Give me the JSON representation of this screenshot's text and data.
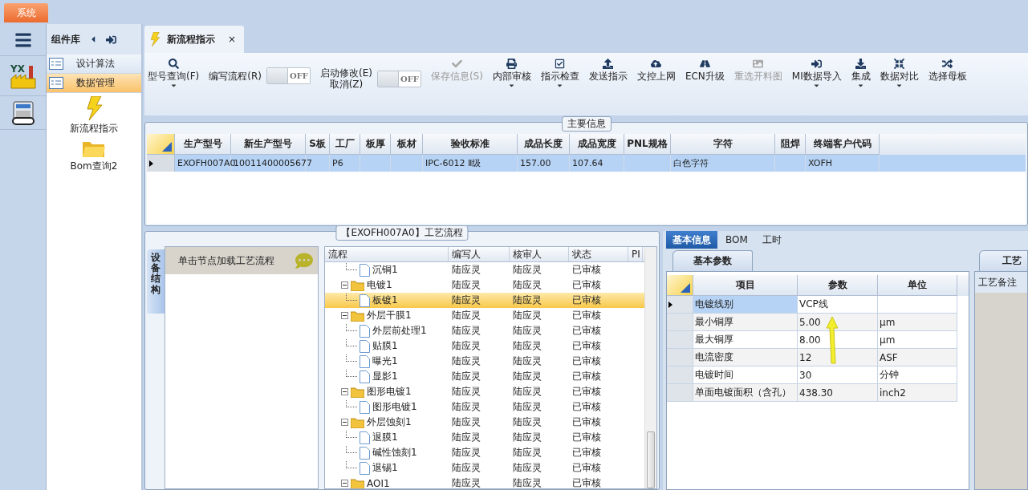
{
  "system_tab": {
    "label": "系统"
  },
  "sidebar": {
    "logo_text": "YX"
  },
  "component_library": {
    "title": "组件库",
    "categories": [
      {
        "label": "设计算法",
        "selected": false
      },
      {
        "label": "数据管理",
        "selected": true
      }
    ],
    "items": [
      {
        "label": "新流程指示"
      },
      {
        "label": "Bom查询2"
      }
    ]
  },
  "document_tab": {
    "title": "新流程指示",
    "close": "×"
  },
  "toolbar": [
    {
      "kind": "button",
      "lines": [
        "型号查询(F)"
      ],
      "dropdown": true,
      "disabled": false
    },
    {
      "kind": "toggle",
      "lines": [
        "编写流程(R)"
      ],
      "state": "OFF",
      "on": false
    },
    {
      "kind": "toggle",
      "lines": [
        "启动修改(E)",
        "取消(Z)"
      ],
      "state": "OFF",
      "on": false
    },
    {
      "kind": "button",
      "lines": [
        "保存信息(S)"
      ],
      "dropdown": false,
      "disabled": true
    },
    {
      "kind": "button",
      "lines": [
        "内部审核"
      ],
      "dropdown": true,
      "disabled": false
    },
    {
      "kind": "button",
      "lines": [
        "指示检查"
      ],
      "dropdown": true,
      "disabled": false
    },
    {
      "kind": "button",
      "lines": [
        "发送指示"
      ],
      "dropdown": false,
      "disabled": false
    },
    {
      "kind": "button",
      "lines": [
        "文控上网"
      ],
      "dropdown": false,
      "disabled": false
    },
    {
      "kind": "button",
      "lines": [
        "ECN升级"
      ],
      "dropdown": false,
      "disabled": false
    },
    {
      "kind": "button",
      "lines": [
        "重选开料图"
      ],
      "dropdown": false,
      "disabled": true
    },
    {
      "kind": "button",
      "lines": [
        "MI数据导入"
      ],
      "dropdown": true,
      "disabled": false
    },
    {
      "kind": "button",
      "lines": [
        "集成"
      ],
      "dropdown": true,
      "disabled": false
    },
    {
      "kind": "button",
      "lines": [
        "数据对比"
      ],
      "dropdown": true,
      "disabled": false
    },
    {
      "kind": "button",
      "lines": [
        "选择母板"
      ],
      "dropdown": false,
      "disabled": false
    }
  ],
  "main_info": {
    "title": "主要信息",
    "columns": [
      "生产型号",
      "新生产型号",
      "S板",
      "工厂",
      "板厚",
      "板材",
      "验收标准",
      "成品长度",
      "成品宽度",
      "PNL规格",
      "字符",
      "阻焊",
      "终端客户代码"
    ],
    "rows": [
      {
        "selected": true,
        "cells": [
          "EXOFH007A0",
          "10011400005677",
          null,
          "P6",
          null,
          null,
          "IPC-6012 Ⅱ级",
          "157.00",
          "107.64",
          null,
          "白色字符",
          null,
          "XOFH"
        ]
      }
    ]
  },
  "process_flow": {
    "title": "【EXOFH007A0】工艺流程",
    "side_tab": "设备结构",
    "hint": "单击节点加载工艺流程",
    "columns": [
      "流程",
      "编写人",
      "核审人",
      "状态",
      "PI"
    ],
    "rows": [
      {
        "kind": "doc",
        "name": "沉铜1",
        "author": "陆应灵",
        "reviewer": "陆应灵",
        "status": "已审核",
        "selected": false
      },
      {
        "kind": "folder",
        "name": "电镀1",
        "author": "陆应灵",
        "reviewer": "陆应灵",
        "status": "已审核",
        "selected": false,
        "expanded": true,
        "children": [
          {
            "kind": "doc",
            "name": "板镀1",
            "author": "陆应灵",
            "reviewer": "陆应灵",
            "status": "已审核",
            "selected": true
          }
        ]
      },
      {
        "kind": "folder",
        "name": "外层干膜1",
        "author": "陆应灵",
        "reviewer": "陆应灵",
        "status": "已审核",
        "selected": false,
        "expanded": true,
        "children": [
          {
            "kind": "doc",
            "name": "外层前处理1",
            "author": "陆应灵",
            "reviewer": "陆应灵",
            "status": "已审核",
            "selected": false
          },
          {
            "kind": "doc",
            "name": "贴膜1",
            "author": "陆应灵",
            "reviewer": "陆应灵",
            "status": "已审核",
            "selected": false
          },
          {
            "kind": "doc",
            "name": "曝光1",
            "author": "陆应灵",
            "reviewer": "陆应灵",
            "status": "已审核",
            "selected": false
          },
          {
            "kind": "doc",
            "name": "显影1",
            "author": "陆应灵",
            "reviewer": "陆应灵",
            "status": "已审核",
            "selected": false
          }
        ]
      },
      {
        "kind": "folder",
        "name": "图形电镀1",
        "author": "陆应灵",
        "reviewer": "陆应灵",
        "status": "已审核",
        "selected": false,
        "expanded": true,
        "children": [
          {
            "kind": "doc",
            "name": "图形电镀1",
            "author": "陆应灵",
            "reviewer": "陆应灵",
            "status": "已审核",
            "selected": false
          }
        ]
      },
      {
        "kind": "folder",
        "name": "外层蚀刻1",
        "author": "陆应灵",
        "reviewer": "陆应灵",
        "status": "已审核",
        "selected": false,
        "expanded": true,
        "children": [
          {
            "kind": "doc",
            "name": "退膜1",
            "author": "陆应灵",
            "reviewer": "陆应灵",
            "status": "已审核",
            "selected": false
          },
          {
            "kind": "doc",
            "name": "碱性蚀刻1",
            "author": "陆应灵",
            "reviewer": "陆应灵",
            "status": "已审核",
            "selected": false
          },
          {
            "kind": "doc",
            "name": "退锡1",
            "author": "陆应灵",
            "reviewer": "陆应灵",
            "status": "已审核",
            "selected": false
          }
        ]
      },
      {
        "kind": "folder",
        "name": "AOI1",
        "author": "陆应灵",
        "reviewer": "陆应灵",
        "status": "已审核",
        "selected": false,
        "expanded": true
      }
    ]
  },
  "detail": {
    "tabs": [
      {
        "label": "基本信息",
        "selected": true
      },
      {
        "label": "BOM",
        "selected": false
      },
      {
        "label": "工时",
        "selected": false
      }
    ],
    "subtab": "基本参数",
    "columns": [
      "项目",
      "参数",
      "单位"
    ],
    "rows": [
      {
        "item": "电镀线别",
        "value": "VCP线",
        "selected": true
      },
      {
        "item": "最小铜厚",
        "value": "5.00",
        "unit": "μm",
        "selected": false
      },
      {
        "item": "最大铜厚",
        "value": "8.00",
        "unit": "μm",
        "selected": false
      },
      {
        "item": "电流密度",
        "value": "12",
        "unit": "ASF",
        "selected": false
      },
      {
        "item": "电镀时间",
        "value": "30",
        "unit": "分钟",
        "selected": false
      },
      {
        "item": "单面电镀面积（含孔）",
        "value": "438.30",
        "unit": "inch2",
        "selected": false
      }
    ],
    "side_title": "工艺",
    "side_label": "工艺备注"
  }
}
